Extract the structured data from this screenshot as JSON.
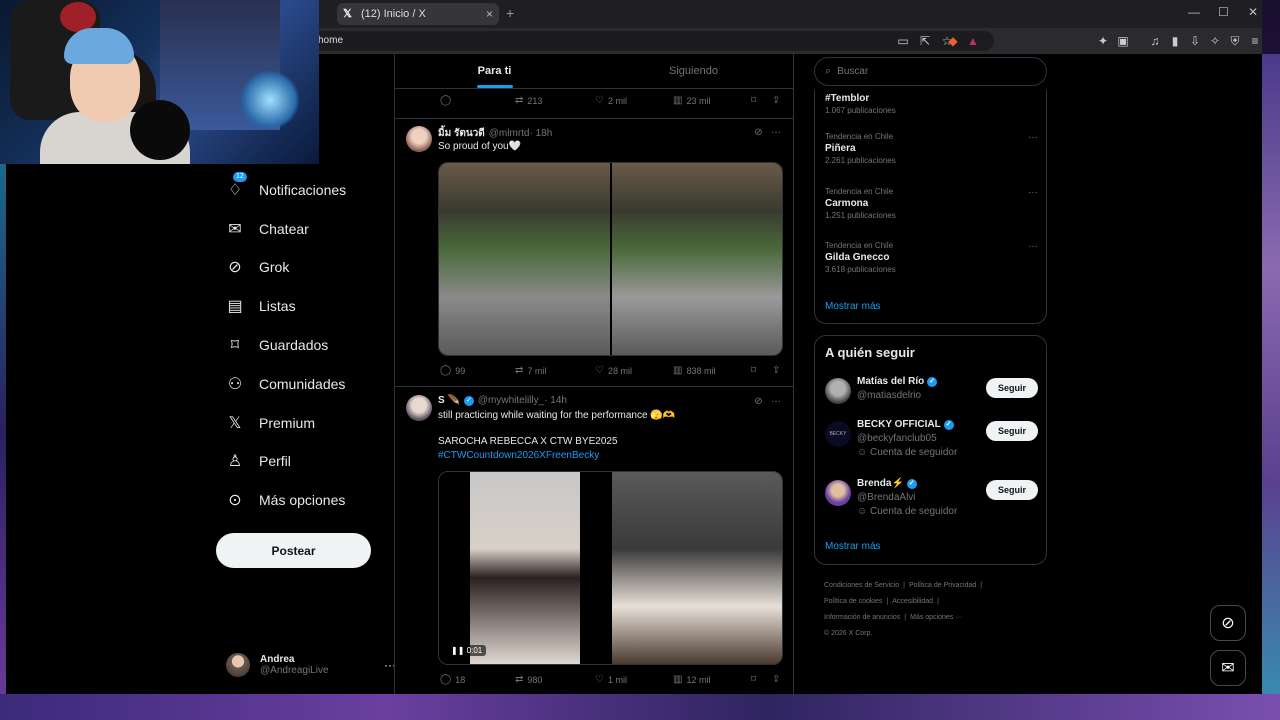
{
  "browser": {
    "tab_title": "(12) Inicio / X",
    "url": "home",
    "new_tab": "+",
    "close_tab": "×",
    "window": {
      "minimize": "—",
      "maximize": "☐",
      "close": "✕"
    }
  },
  "nav": {
    "notifications_badge": "12",
    "items": [
      {
        "label": "Notificaciones",
        "icon": "bell-icon"
      },
      {
        "label": "Chatear",
        "icon": "mail-icon"
      },
      {
        "label": "Grok",
        "icon": "grok-icon"
      },
      {
        "label": "Listas",
        "icon": "list-icon"
      },
      {
        "label": "Guardados",
        "icon": "bookmark-icon"
      },
      {
        "label": "Comunidades",
        "icon": "people-icon"
      },
      {
        "label": "Premium",
        "icon": "x-icon"
      },
      {
        "label": "Perfil",
        "icon": "person-icon"
      },
      {
        "label": "Más opciones",
        "icon": "more-circle-icon"
      }
    ],
    "post_button": "Postear"
  },
  "account": {
    "name": "Andrea",
    "handle": "@AndreagiLive",
    "more": "···"
  },
  "feed": {
    "tabs": [
      {
        "label": "Para ti",
        "active": true
      },
      {
        "label": "Siguiendo",
        "active": false
      }
    ],
    "top_actions": {
      "retweets": "213",
      "likes": "2 mil",
      "views": "23 mil"
    },
    "tweets": [
      {
        "name": "มิ้ม รัตนวดี",
        "handle": "@mlmrtd",
        "time": "· 18h",
        "text": "So proud of you🤍",
        "actions": {
          "replies": "99",
          "retweets": "7 mil",
          "likes": "28 mil",
          "views": "838 mil"
        }
      },
      {
        "name": "S 🪶",
        "handle": "@mywhitelilly_",
        "time": "· 14h",
        "text_lines": [
          "still practicing while waiting for the performance 🫣🫶",
          "SAROCHA REBECCA X CTW BYE2025"
        ],
        "hashtag": "#CTWCountdown2026XFreenBecky",
        "video_time": "0:01",
        "actions": {
          "replies": "18",
          "retweets": "980",
          "likes": "1 mil",
          "views": "12 mil"
        }
      }
    ]
  },
  "right": {
    "search_placeholder": "Buscar",
    "trends": [
      {
        "context": "",
        "name": "#Temblor",
        "count": "1.067 publicaciones"
      },
      {
        "context": "Tendencia en Chile",
        "name": "Piñera",
        "count": "2.261 publicaciones"
      },
      {
        "context": "Tendencia en Chile",
        "name": "Carmona",
        "count": "1.251 publicaciones"
      },
      {
        "context": "Tendencia en Chile",
        "name": "Gilda Gnecco",
        "count": "3.618 publicaciones"
      }
    ],
    "show_more": "Mostrar más",
    "who_to_follow": {
      "title": "A quién seguir",
      "users": [
        {
          "name": "Matías del Río",
          "handle": "@matiasdelrio",
          "sub": "",
          "button": "Seguir"
        },
        {
          "name": "BECKY OFFICIAL",
          "handle": "@beckyfanclub05",
          "sub": "Cuenta de seguidor",
          "button": "Seguir"
        },
        {
          "name": "Brenda⚡",
          "handle": "@BrendaAlvi",
          "sub": "Cuenta de seguidor",
          "button": "Seguir"
        }
      ],
      "show_more": "Mostrar más"
    },
    "footer": [
      "Condiciones de Servicio",
      "|",
      "Política de Privacidad",
      "|",
      "Política de cookies",
      "|",
      "Accesibilidad",
      "|",
      "Información de anuncios",
      "|",
      "Más opciones ···",
      "© 2026 X Corp."
    ]
  },
  "colors": {
    "accent": "#1d9bf0",
    "bg": "#000000",
    "border": "#2f3336",
    "muted": "#71767b"
  }
}
